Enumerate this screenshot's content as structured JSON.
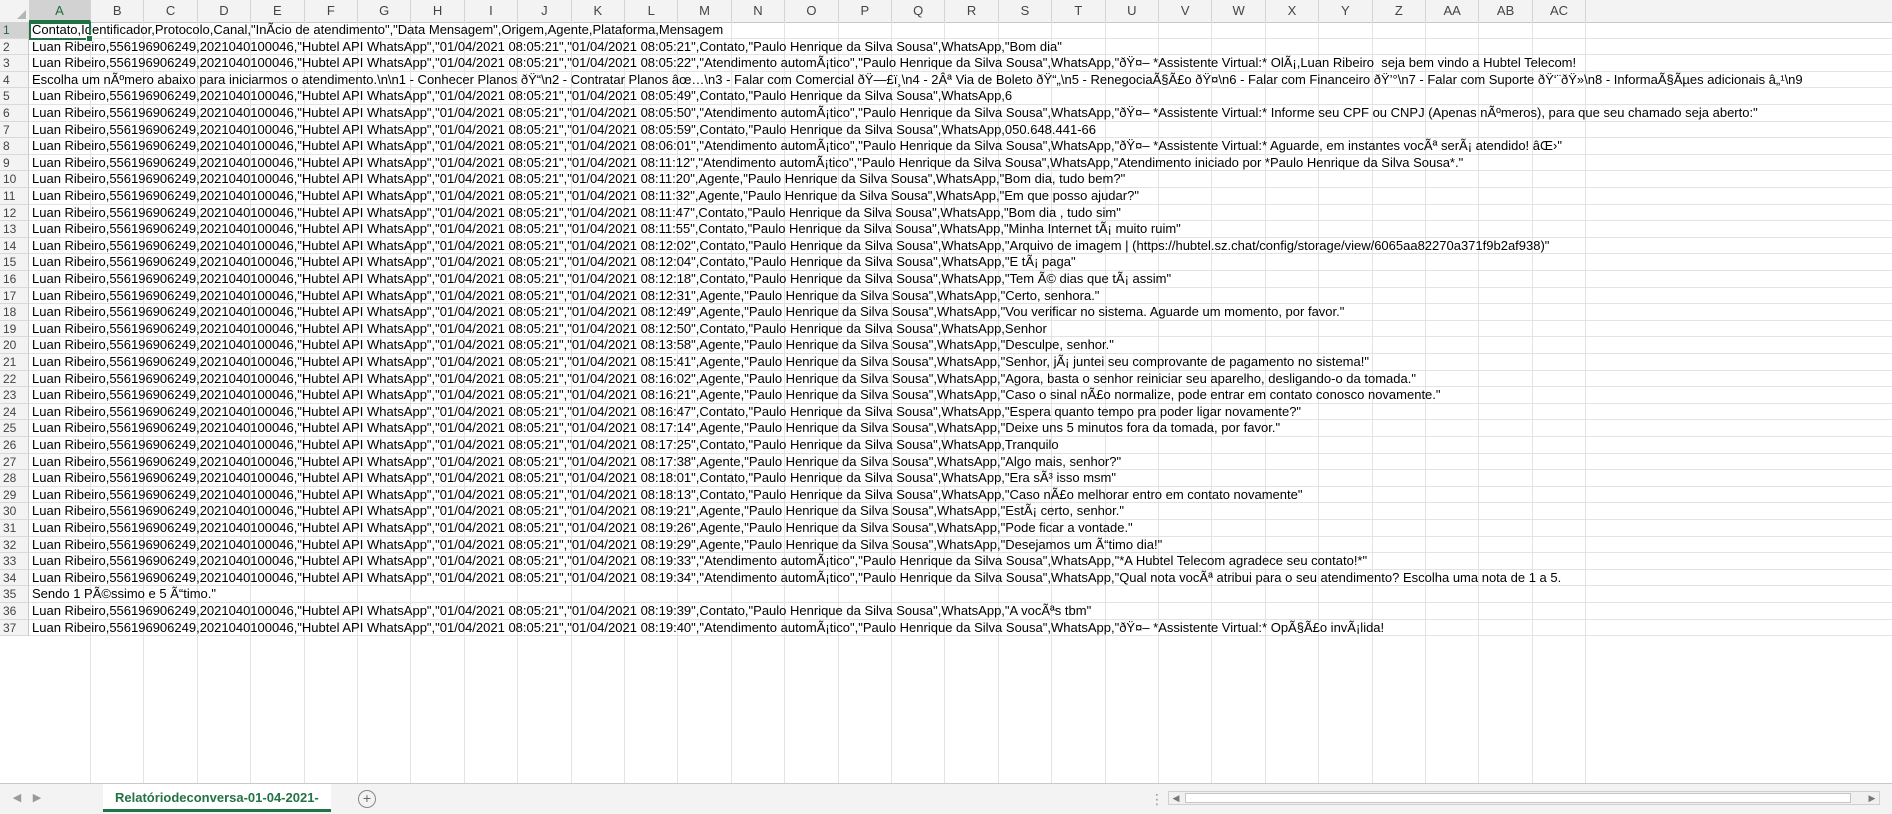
{
  "columns": [
    "A",
    "B",
    "C",
    "D",
    "E",
    "F",
    "G",
    "H",
    "I",
    "J",
    "K",
    "L",
    "M",
    "N",
    "O",
    "P",
    "Q",
    "R",
    "S",
    "T",
    "U",
    "V",
    "W",
    "X",
    "Y",
    "Z",
    "AA",
    "AB",
    "AC"
  ],
  "selected_column": "A",
  "selected_row": "1",
  "rows": [
    {
      "n": "1",
      "text": "Contato,Identificador,Protocolo,Canal,\"InÃ­cio de atendimento\",\"Data Mensagem\",Origem,Agente,Plataforma,Mensagem"
    },
    {
      "n": "2",
      "text": "Luan Ribeiro,556196906249,2021040100046,\"Hubtel API WhatsApp\",\"01/04/2021 08:05:21\",\"01/04/2021 08:05:21\",Contato,\"Paulo Henrique da Silva Sousa\",WhatsApp,\"Bom dia\""
    },
    {
      "n": "3",
      "text": "Luan Ribeiro,556196906249,2021040100046,\"Hubtel API WhatsApp\",\"01/04/2021 08:05:21\",\"01/04/2021 08:05:22\",\"Atendimento automÃ¡tico\",\"Paulo Henrique da Silva Sousa\",WhatsApp,\"ðŸ¤– *Assistente Virtual:* OlÃ¡,Luan Ribeiro  seja bem vindo a Hubtel Telecom!"
    },
    {
      "n": "4",
      "text": "Escolha um nÃºmero abaixo para iniciarmos o atendimento.\\n\\n1 - Conhecer Planos ðŸ“\\n2 - Contratar Planos âœ…\\n3 - Falar com Comercial ðŸ—£ï¸\\n4 - 2Âª Via de Boleto ðŸ“„\\n5 - RenegociaÃ§Ã£o ðŸ¤\\n6 - Falar com Financeiro ðŸ’°\\n7 - Falar com Suporte ðŸ‘¨ðŸ»\\n8 - InformaÃ§Ãµes adicionais â„¹\\n9"
    },
    {
      "n": "5",
      "text": "Luan Ribeiro,556196906249,2021040100046,\"Hubtel API WhatsApp\",\"01/04/2021 08:05:21\",\"01/04/2021 08:05:49\",Contato,\"Paulo Henrique da Silva Sousa\",WhatsApp,6"
    },
    {
      "n": "6",
      "text": "Luan Ribeiro,556196906249,2021040100046,\"Hubtel API WhatsApp\",\"01/04/2021 08:05:21\",\"01/04/2021 08:05:50\",\"Atendimento automÃ¡tico\",\"Paulo Henrique da Silva Sousa\",WhatsApp,\"ðŸ¤– *Assistente Virtual:* Informe seu CPF ou CNPJ (Apenas nÃºmeros), para que seu chamado seja aberto:\""
    },
    {
      "n": "7",
      "text": "Luan Ribeiro,556196906249,2021040100046,\"Hubtel API WhatsApp\",\"01/04/2021 08:05:21\",\"01/04/2021 08:05:59\",Contato,\"Paulo Henrique da Silva Sousa\",WhatsApp,050.648.441-66"
    },
    {
      "n": "8",
      "text": "Luan Ribeiro,556196906249,2021040100046,\"Hubtel API WhatsApp\",\"01/04/2021 08:05:21\",\"01/04/2021 08:06:01\",\"Atendimento automÃ¡tico\",\"Paulo Henrique da Silva Sousa\",WhatsApp,\"ðŸ¤– *Assistente Virtual:* Aguarde, em instantes vocÃª serÃ¡ atendido! âŒ›\""
    },
    {
      "n": "9",
      "text": "Luan Ribeiro,556196906249,2021040100046,\"Hubtel API WhatsApp\",\"01/04/2021 08:05:21\",\"01/04/2021 08:11:12\",\"Atendimento automÃ¡tico\",\"Paulo Henrique da Silva Sousa\",WhatsApp,\"Atendimento iniciado por *Paulo Henrique da Silva Sousa*.\""
    },
    {
      "n": "10",
      "text": "Luan Ribeiro,556196906249,2021040100046,\"Hubtel API WhatsApp\",\"01/04/2021 08:05:21\",\"01/04/2021 08:11:20\",Agente,\"Paulo Henrique da Silva Sousa\",WhatsApp,\"Bom dia, tudo bem?\""
    },
    {
      "n": "11",
      "text": "Luan Ribeiro,556196906249,2021040100046,\"Hubtel API WhatsApp\",\"01/04/2021 08:05:21\",\"01/04/2021 08:11:32\",Agente,\"Paulo Henrique da Silva Sousa\",WhatsApp,\"Em que posso ajudar?\""
    },
    {
      "n": "12",
      "text": "Luan Ribeiro,556196906249,2021040100046,\"Hubtel API WhatsApp\",\"01/04/2021 08:05:21\",\"01/04/2021 08:11:47\",Contato,\"Paulo Henrique da Silva Sousa\",WhatsApp,\"Bom dia , tudo sim\""
    },
    {
      "n": "13",
      "text": "Luan Ribeiro,556196906249,2021040100046,\"Hubtel API WhatsApp\",\"01/04/2021 08:05:21\",\"01/04/2021 08:11:55\",Contato,\"Paulo Henrique da Silva Sousa\",WhatsApp,\"Minha Internet tÃ¡ muito ruim\""
    },
    {
      "n": "14",
      "text": "Luan Ribeiro,556196906249,2021040100046,\"Hubtel API WhatsApp\",\"01/04/2021 08:05:21\",\"01/04/2021 08:12:02\",Contato,\"Paulo Henrique da Silva Sousa\",WhatsApp,\"Arquivo de imagem | (https://hubtel.sz.chat/config/storage/view/6065aa82270a371f9b2af938)\""
    },
    {
      "n": "15",
      "text": "Luan Ribeiro,556196906249,2021040100046,\"Hubtel API WhatsApp\",\"01/04/2021 08:05:21\",\"01/04/2021 08:12:04\",Contato,\"Paulo Henrique da Silva Sousa\",WhatsApp,\"E tÃ¡ paga\""
    },
    {
      "n": "16",
      "text": "Luan Ribeiro,556196906249,2021040100046,\"Hubtel API WhatsApp\",\"01/04/2021 08:05:21\",\"01/04/2021 08:12:18\",Contato,\"Paulo Henrique da Silva Sousa\",WhatsApp,\"Tem Ã© dias que tÃ¡ assim\""
    },
    {
      "n": "17",
      "text": "Luan Ribeiro,556196906249,2021040100046,\"Hubtel API WhatsApp\",\"01/04/2021 08:05:21\",\"01/04/2021 08:12:31\",Agente,\"Paulo Henrique da Silva Sousa\",WhatsApp,\"Certo, senhora.\""
    },
    {
      "n": "18",
      "text": "Luan Ribeiro,556196906249,2021040100046,\"Hubtel API WhatsApp\",\"01/04/2021 08:05:21\",\"01/04/2021 08:12:49\",Agente,\"Paulo Henrique da Silva Sousa\",WhatsApp,\"Vou verificar no sistema. Aguarde um momento, por favor.\""
    },
    {
      "n": "19",
      "text": "Luan Ribeiro,556196906249,2021040100046,\"Hubtel API WhatsApp\",\"01/04/2021 08:05:21\",\"01/04/2021 08:12:50\",Contato,\"Paulo Henrique da Silva Sousa\",WhatsApp,Senhor"
    },
    {
      "n": "20",
      "text": "Luan Ribeiro,556196906249,2021040100046,\"Hubtel API WhatsApp\",\"01/04/2021 08:05:21\",\"01/04/2021 08:13:58\",Agente,\"Paulo Henrique da Silva Sousa\",WhatsApp,\"Desculpe, senhor.\""
    },
    {
      "n": "21",
      "text": "Luan Ribeiro,556196906249,2021040100046,\"Hubtel API WhatsApp\",\"01/04/2021 08:05:21\",\"01/04/2021 08:15:41\",Agente,\"Paulo Henrique da Silva Sousa\",WhatsApp,\"Senhor, jÃ¡ juntei seu comprovante de pagamento no sistema!\""
    },
    {
      "n": "22",
      "text": "Luan Ribeiro,556196906249,2021040100046,\"Hubtel API WhatsApp\",\"01/04/2021 08:05:21\",\"01/04/2021 08:16:02\",Agente,\"Paulo Henrique da Silva Sousa\",WhatsApp,\"Agora, basta o senhor reiniciar seu aparelho, desligando-o da tomada.\""
    },
    {
      "n": "23",
      "text": "Luan Ribeiro,556196906249,2021040100046,\"Hubtel API WhatsApp\",\"01/04/2021 08:05:21\",\"01/04/2021 08:16:21\",Agente,\"Paulo Henrique da Silva Sousa\",WhatsApp,\"Caso o sinal nÃ£o normalize, pode entrar em contato conosco novamente.\""
    },
    {
      "n": "24",
      "text": "Luan Ribeiro,556196906249,2021040100046,\"Hubtel API WhatsApp\",\"01/04/2021 08:05:21\",\"01/04/2021 08:16:47\",Contato,\"Paulo Henrique da Silva Sousa\",WhatsApp,\"Espera quanto tempo pra poder ligar novamente?\""
    },
    {
      "n": "25",
      "text": "Luan Ribeiro,556196906249,2021040100046,\"Hubtel API WhatsApp\",\"01/04/2021 08:05:21\",\"01/04/2021 08:17:14\",Agente,\"Paulo Henrique da Silva Sousa\",WhatsApp,\"Deixe uns 5 minutos fora da tomada, por favor.\""
    },
    {
      "n": "26",
      "text": "Luan Ribeiro,556196906249,2021040100046,\"Hubtel API WhatsApp\",\"01/04/2021 08:05:21\",\"01/04/2021 08:17:25\",Contato,\"Paulo Henrique da Silva Sousa\",WhatsApp,Tranquilo"
    },
    {
      "n": "27",
      "text": "Luan Ribeiro,556196906249,2021040100046,\"Hubtel API WhatsApp\",\"01/04/2021 08:05:21\",\"01/04/2021 08:17:38\",Agente,\"Paulo Henrique da Silva Sousa\",WhatsApp,\"Algo mais, senhor?\""
    },
    {
      "n": "28",
      "text": "Luan Ribeiro,556196906249,2021040100046,\"Hubtel API WhatsApp\",\"01/04/2021 08:05:21\",\"01/04/2021 08:18:01\",Contato,\"Paulo Henrique da Silva Sousa\",WhatsApp,\"Era sÃ³ isso msm\""
    },
    {
      "n": "29",
      "text": "Luan Ribeiro,556196906249,2021040100046,\"Hubtel API WhatsApp\",\"01/04/2021 08:05:21\",\"01/04/2021 08:18:13\",Contato,\"Paulo Henrique da Silva Sousa\",WhatsApp,\"Caso nÃ£o melhorar entro em contato novamente\""
    },
    {
      "n": "30",
      "text": "Luan Ribeiro,556196906249,2021040100046,\"Hubtel API WhatsApp\",\"01/04/2021 08:05:21\",\"01/04/2021 08:19:21\",Agente,\"Paulo Henrique da Silva Sousa\",WhatsApp,\"EstÃ¡ certo, senhor.\""
    },
    {
      "n": "31",
      "text": "Luan Ribeiro,556196906249,2021040100046,\"Hubtel API WhatsApp\",\"01/04/2021 08:05:21\",\"01/04/2021 08:19:26\",Agente,\"Paulo Henrique da Silva Sousa\",WhatsApp,\"Pode ficar a vontade.\""
    },
    {
      "n": "32",
      "text": "Luan Ribeiro,556196906249,2021040100046,\"Hubtel API WhatsApp\",\"01/04/2021 08:05:21\",\"01/04/2021 08:19:29\",Agente,\"Paulo Henrique da Silva Sousa\",WhatsApp,\"Desejamos um Ã“timo dia!\""
    },
    {
      "n": "33",
      "text": "Luan Ribeiro,556196906249,2021040100046,\"Hubtel API WhatsApp\",\"01/04/2021 08:05:21\",\"01/04/2021 08:19:33\",\"Atendimento automÃ¡tico\",\"Paulo Henrique da Silva Sousa\",WhatsApp,\"*A Hubtel Telecom agradece seu contato!*\""
    },
    {
      "n": "34",
      "text": "Luan Ribeiro,556196906249,2021040100046,\"Hubtel API WhatsApp\",\"01/04/2021 08:05:21\",\"01/04/2021 08:19:34\",\"Atendimento automÃ¡tico\",\"Paulo Henrique da Silva Sousa\",WhatsApp,\"Qual nota vocÃª atribui para o seu atendimento? Escolha uma nota de 1 a 5."
    },
    {
      "n": "35",
      "text": "Sendo 1 PÃ©ssimo e 5 Ã“timo.\""
    },
    {
      "n": "36",
      "text": "Luan Ribeiro,556196906249,2021040100046,\"Hubtel API WhatsApp\",\"01/04/2021 08:05:21\",\"01/04/2021 08:19:39\",Contato,\"Paulo Henrique da Silva Sousa\",WhatsApp,\"A vocÃªs tbm\""
    },
    {
      "n": "37",
      "text": "Luan Ribeiro,556196906249,2021040100046,\"Hubtel API WhatsApp\",\"01/04/2021 08:05:21\",\"01/04/2021 08:19:40\",\"Atendimento automÃ¡tico\",\"Paulo Henrique da Silva Sousa\",WhatsApp,\"ðŸ¤– *Assistente Virtual:* OpÃ§Ã£o invÃ¡lida!"
    }
  ],
  "sheet_tab": "Relatóriodeconversa-01-04-2021-",
  "add_sheet_icon": "plus-circle-icon",
  "accent_color": "#217346"
}
